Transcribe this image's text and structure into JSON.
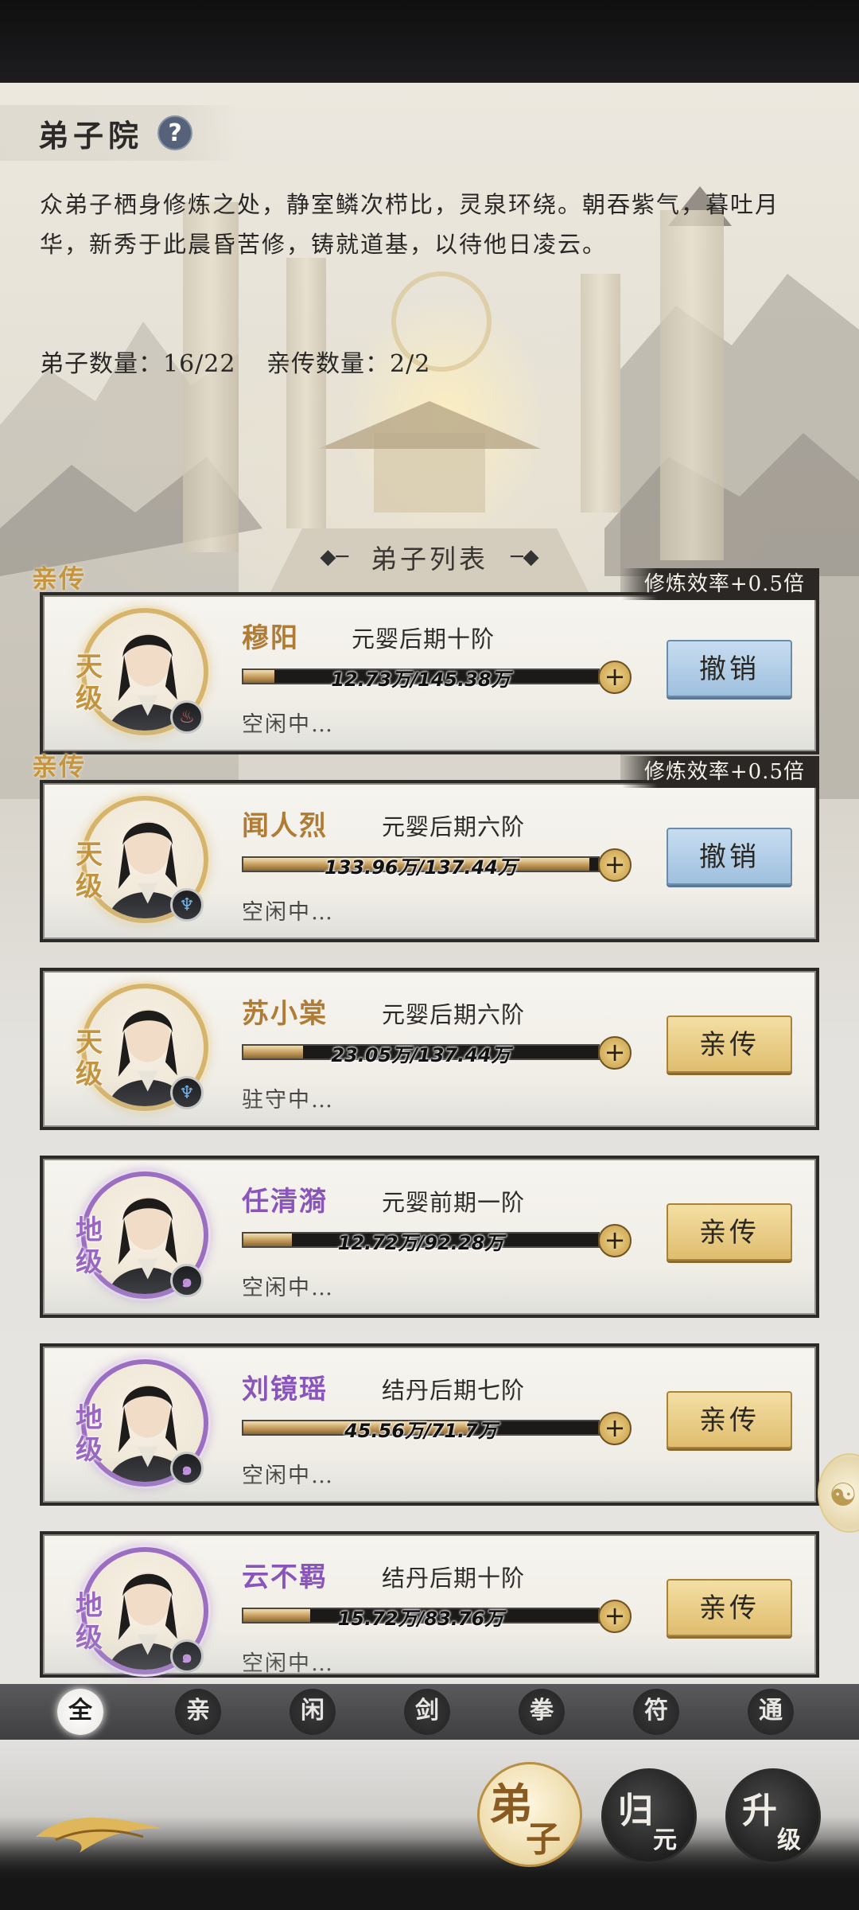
{
  "page": {
    "title": "弟子院",
    "help_icon": "?",
    "description": "众弟子栖身修炼之处，静室鳞次栉比，灵泉环绕。朝吞紫气，暮吐月华，新秀于此晨昏苦修，铸就道基，以待他日凌云。",
    "disciple_count": "弟子数量：16/22",
    "direct_count": "亲传数量：2/2",
    "list_header": "弟子列表"
  },
  "disciples": [
    {
      "name": "穆阳",
      "realm": "元婴后期十阶",
      "progress_text": "12.73万/145.38万",
      "progress": 0.0876,
      "status": "空闲中…",
      "rank": "天级",
      "rank_color": "gold",
      "element_icon": "fire-element-icon",
      "action": "撤销",
      "action_type": "revoke",
      "direct_label": "亲传",
      "bonus": "修炼效率+0.5倍"
    },
    {
      "name": "闻人烈",
      "realm": "元婴后期六阶",
      "progress_text": "133.96万/137.44万",
      "progress": 0.9747,
      "status": "空闲中…",
      "rank": "天级",
      "rank_color": "gold",
      "element_icon": "water-element-icon",
      "action": "撤销",
      "action_type": "revoke",
      "direct_label": "亲传",
      "bonus": "修炼效率+0.5倍"
    },
    {
      "name": "苏小棠",
      "realm": "元婴后期六阶",
      "progress_text": "23.05万/137.44万",
      "progress": 0.1677,
      "status": "驻守中…",
      "rank": "天级",
      "rank_color": "gold",
      "element_icon": "water-element-icon",
      "action": "亲传",
      "action_type": "direct"
    },
    {
      "name": "任清漪",
      "realm": "元婴前期一阶",
      "progress_text": "12.72万/92.28万",
      "progress": 0.1378,
      "status": "空闲中…",
      "rank": "地级",
      "rank_color": "purple",
      "element_icon": "wind-element-icon",
      "action": "亲传",
      "action_type": "direct"
    },
    {
      "name": "刘镜瑶",
      "realm": "结丹后期七阶",
      "progress_text": "45.56万/71.7万",
      "progress": 0.6354,
      "status": "空闲中…",
      "rank": "地级",
      "rank_color": "purple",
      "element_icon": "wind-element-icon",
      "action": "亲传",
      "action_type": "direct"
    },
    {
      "name": "云不羁",
      "realm": "结丹后期十阶",
      "progress_text": "15.72万/83.76万",
      "progress": 0.1877,
      "status": "空闲中…",
      "rank": "地级",
      "rank_color": "purple",
      "element_icon": "wind-element-icon",
      "action": "亲传",
      "action_type": "direct"
    }
  ],
  "filters": [
    "全",
    "亲",
    "闲",
    "剑",
    "拳",
    "符",
    "通"
  ],
  "active_filter": "全",
  "nav": [
    {
      "char1": "弟",
      "char2": "子",
      "active": true
    },
    {
      "char1": "归",
      "char2": "元",
      "active": false
    },
    {
      "char1": "升",
      "char2": "级",
      "active": false
    }
  ],
  "colors": {
    "gold_rank": "#c3943e",
    "purple_rank": "#9966c0",
    "revoke_button": "#9fc0df",
    "direct_button": "#dfbd6e"
  }
}
